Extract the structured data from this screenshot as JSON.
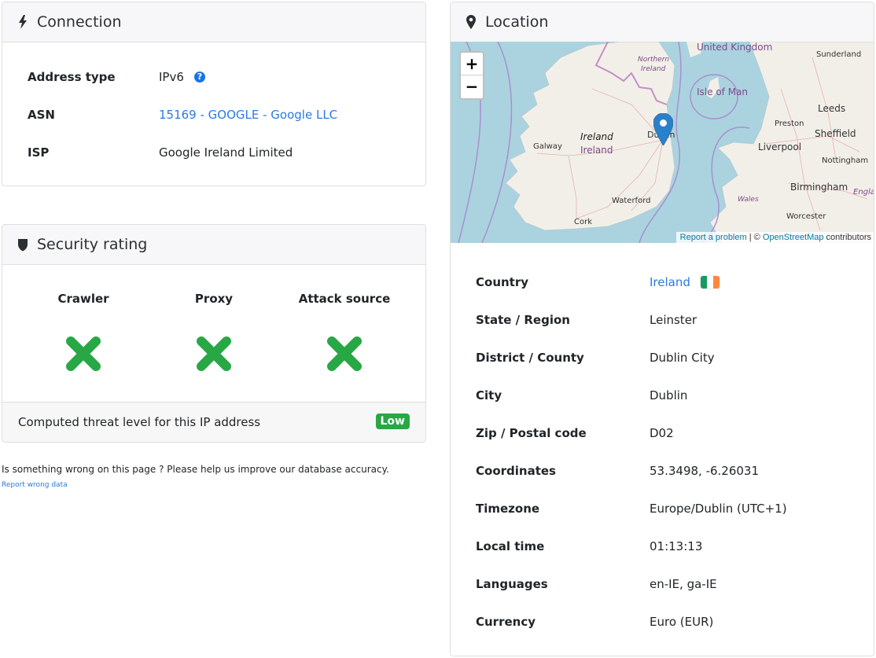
{
  "connection": {
    "title": "Connection",
    "icon": "bolt-icon",
    "rows": [
      {
        "label": "Address type",
        "value": "IPv6",
        "help_icon": "question-circle-icon"
      },
      {
        "label": "ASN",
        "value": "15169 - GOOGLE - Google LLC",
        "link": true
      },
      {
        "label": "ISP",
        "value": "Google Ireland Limited"
      }
    ]
  },
  "security": {
    "title": "Security rating",
    "icon": "shield-icon",
    "checks": [
      {
        "label": "Crawler",
        "result": "no",
        "icon": "cross-icon"
      },
      {
        "label": "Proxy",
        "result": "no",
        "icon": "cross-icon"
      },
      {
        "label": "Attack source",
        "result": "no",
        "icon": "cross-icon"
      }
    ],
    "footer_text": "Computed threat level for this IP address",
    "threat_level": "Low",
    "threat_color": "#28a745",
    "cross_color": "#28a745"
  },
  "report": {
    "text": "Is something wrong on this page ? Please help us improve our database accuracy.",
    "link": "Report wrong data"
  },
  "location": {
    "title": "Location",
    "icon": "map-marker-icon",
    "map": {
      "zoom_in": "+",
      "zoom_out": "−",
      "labels": {
        "united_kingdom": "United Kingdom",
        "northern_ireland_1": "Northern",
        "northern_ireland_2": "Ireland",
        "isle_of_man": "Isle of Man",
        "sunderland": "Sunderland",
        "leeds": "Leeds",
        "preston": "Preston",
        "sheffield": "Sheffield",
        "liverpool": "Liverpool",
        "nottingham": "Nottingham",
        "birmingham": "Birmingham",
        "england": "Engla",
        "wales": "Wales",
        "worcester": "Worcester",
        "ireland_italic": "Ireland",
        "ireland_country": "Ireland",
        "galway": "Galway",
        "dublin": "Dublin",
        "waterford": "Waterford",
        "cork": "Cork"
      },
      "attribution_report": "Report a problem",
      "attribution_sep": " | © ",
      "attribution_osm": "OpenStreetMap",
      "attribution_tail": " contributors"
    },
    "rows": [
      {
        "label": "Country",
        "value": "Ireland",
        "link": true,
        "flag": [
          "#169b62",
          "#ffffff",
          "#ff883e"
        ]
      },
      {
        "label": "State / Region",
        "value": "Leinster"
      },
      {
        "label": "District / County",
        "value": "Dublin City"
      },
      {
        "label": "City",
        "value": "Dublin"
      },
      {
        "label": "Zip / Postal code",
        "value": "D02"
      },
      {
        "label": "Coordinates",
        "value": "53.3498, -6.26031"
      },
      {
        "label": "Timezone",
        "value": "Europe/Dublin (UTC+1)"
      },
      {
        "label": "Local time",
        "value": "01:13:13"
      },
      {
        "label": "Languages",
        "value": "en-IE, ga-IE"
      },
      {
        "label": "Currency",
        "value": "Euro (EUR)"
      }
    ]
  }
}
